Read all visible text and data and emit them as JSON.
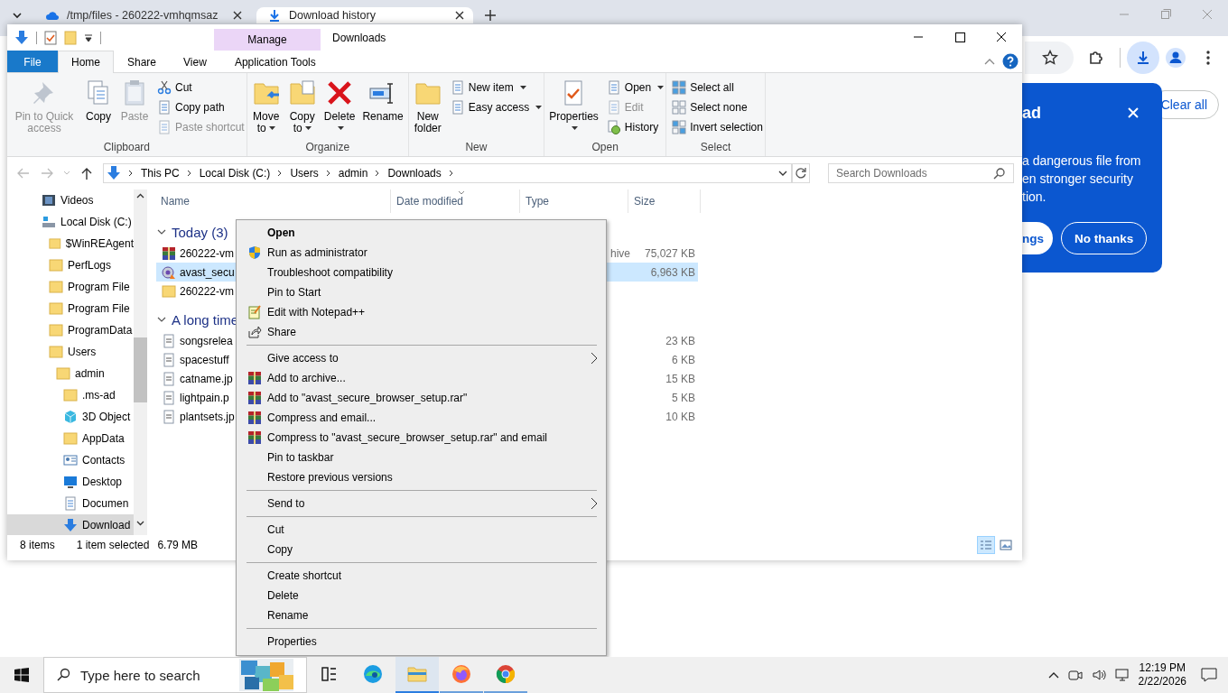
{
  "browser": {
    "tabs": [
      {
        "title": "/tmp/files - 260222-vmhqmsaz",
        "selected": false
      },
      {
        "title": "Download history",
        "selected": true
      }
    ],
    "download_bubble": {
      "title": "ad",
      "message_lines": [
        "a dangerous file from",
        "en stronger security",
        "tion."
      ],
      "buttons": [
        "ngs",
        "No thanks"
      ]
    },
    "page": {
      "clear_all": "Clear all"
    }
  },
  "explorer": {
    "title": "Downloads",
    "contextual_tab": "Manage",
    "ribbon_tabs": [
      {
        "label": "File",
        "selected": false
      },
      {
        "label": "Home",
        "selected": true
      },
      {
        "label": "Share",
        "selected": false
      },
      {
        "label": "View",
        "selected": false
      },
      {
        "label": "Application Tools",
        "selected": false
      }
    ],
    "ribbon_groups": [
      {
        "label": "Clipboard",
        "large": [
          {
            "label": "Pin to Quick access",
            "disabled": true,
            "dropdown": false
          },
          {
            "label": "Copy",
            "disabled": false,
            "dropdown": false
          },
          {
            "label": "Paste",
            "disabled": true,
            "dropdown": false
          }
        ],
        "small": [
          {
            "label": "Cut",
            "disabled": false,
            "dropdown": false
          },
          {
            "label": "Copy path",
            "disabled": false,
            "dropdown": false
          },
          {
            "label": "Paste shortcut",
            "disabled": true,
            "dropdown": false
          }
        ]
      },
      {
        "label": "Organize",
        "large": [
          {
            "label": "Move to",
            "disabled": false,
            "dropdown": true
          },
          {
            "label": "Copy to",
            "disabled": false,
            "dropdown": true
          },
          {
            "label": "Delete",
            "disabled": false,
            "dropdown": true
          },
          {
            "label": "Rename",
            "disabled": false,
            "dropdown": false
          }
        ]
      },
      {
        "label": "New",
        "large": [
          {
            "label": "New folder",
            "disabled": false,
            "dropdown": false
          }
        ],
        "small": [
          {
            "label": "New item",
            "disabled": false,
            "dropdown": true
          },
          {
            "label": "Easy access",
            "disabled": false,
            "dropdown": true
          }
        ]
      },
      {
        "label": "Open",
        "large": [
          {
            "label": "Properties",
            "disabled": false,
            "dropdown": true
          }
        ],
        "small": [
          {
            "label": "Open",
            "disabled": false,
            "dropdown": true
          },
          {
            "label": "Edit",
            "disabled": true,
            "dropdown": false
          },
          {
            "label": "History",
            "disabled": false,
            "dropdown": false
          }
        ]
      },
      {
        "label": "Select",
        "small": [
          {
            "label": "Select all",
            "disabled": false,
            "dropdown": false
          },
          {
            "label": "Select none",
            "disabled": false,
            "dropdown": false
          },
          {
            "label": "Invert selection",
            "disabled": false,
            "dropdown": false
          }
        ]
      }
    ],
    "breadcrumb": [
      "This PC",
      "Local Disk (C:)",
      "Users",
      "admin",
      "Downloads"
    ],
    "search": {
      "placeholder": "Search Downloads"
    },
    "nav": {
      "items": [
        {
          "label": "Videos",
          "kind": "videos",
          "selected": false
        },
        {
          "label": "Local Disk (C:)",
          "kind": "drive",
          "selected": false,
          "children": [
            {
              "label": "$WinREAgent",
              "kind": "folder",
              "selected": false
            },
            {
              "label": "PerfLogs",
              "kind": "folder",
              "selected": false
            },
            {
              "label": "Program File",
              "kind": "folder",
              "selected": false
            },
            {
              "label": "Program File",
              "kind": "folder",
              "selected": false
            },
            {
              "label": "ProgramData",
              "kind": "folder",
              "selected": false
            },
            {
              "label": "Users",
              "kind": "folder",
              "selected": false,
              "children": [
                {
                  "label": "admin",
                  "kind": "folder",
                  "selected": false,
                  "children": [
                    {
                      "label": ".ms-ad",
                      "kind": "folder",
                      "selected": false
                    },
                    {
                      "label": "3D Object",
                      "kind": "cube",
                      "selected": false
                    },
                    {
                      "label": "AppData",
                      "kind": "folder",
                      "selected": false
                    },
                    {
                      "label": "Contacts",
                      "kind": "contacts",
                      "selected": false
                    },
                    {
                      "label": "Desktop",
                      "kind": "desktop",
                      "selected": false
                    },
                    {
                      "label": "Documen",
                      "kind": "documents",
                      "selected": false
                    },
                    {
                      "label": "Download",
                      "kind": "downloads",
                      "selected": true
                    }
                  ]
                }
              ]
            }
          ]
        }
      ]
    },
    "columns": [
      "Name",
      "Date modified",
      "Type",
      "Size"
    ],
    "groups": [
      {
        "label": "Today (3)",
        "expanded": true,
        "rows": [
          {
            "name": "260222-vm",
            "type": "hive",
            "size": "75,027 KB",
            "kind": "archive",
            "selected": false
          },
          {
            "name": "avast_secu",
            "size": "6,963 KB",
            "kind": "setup",
            "selected": true
          },
          {
            "name": "260222-vm",
            "kind": "folder",
            "selected": false
          }
        ]
      },
      {
        "label": "A long time",
        "expanded": true,
        "rows": [
          {
            "name": "songsrelea",
            "size": "23 KB",
            "kind": "text",
            "selected": false
          },
          {
            "name": "spacestuff",
            "size": "6 KB",
            "kind": "text",
            "selected": false
          },
          {
            "name": "catname.jp",
            "size": "15 KB",
            "kind": "text",
            "selected": false
          },
          {
            "name": "lightpain.p",
            "size": "5 KB",
            "kind": "text",
            "selected": false
          },
          {
            "name": "plantsets.jp",
            "size": "10 KB",
            "kind": "text",
            "selected": false
          }
        ]
      }
    ],
    "status": {
      "count": "8 items",
      "selection": "1 item selected",
      "size": "6.79 MB"
    },
    "views": [
      {
        "selected": true
      },
      {
        "selected": false
      }
    ]
  },
  "context_menu": {
    "sections": [
      [
        {
          "label": "Open",
          "kind": "plain",
          "default": true,
          "submenu": false
        },
        {
          "label": "Run as administrator",
          "kind": "shield",
          "default": false,
          "submenu": false
        },
        {
          "label": "Troubleshoot compatibility",
          "kind": "plain",
          "default": false,
          "submenu": false
        },
        {
          "label": "Pin to Start",
          "kind": "plain",
          "default": false,
          "submenu": false
        },
        {
          "label": "Edit with Notepad++",
          "kind": "notepad",
          "default": false,
          "submenu": false
        },
        {
          "label": "Share",
          "kind": "share",
          "default": false,
          "submenu": false
        }
      ],
      [
        {
          "label": "Give access to",
          "kind": "plain",
          "default": false,
          "submenu": true
        },
        {
          "label": "Add to archive...",
          "kind": "archive",
          "default": false,
          "submenu": false
        },
        {
          "label": "Add to \"avast_secure_browser_setup.rar\"",
          "kind": "archive",
          "default": false,
          "submenu": false
        },
        {
          "label": "Compress and email...",
          "kind": "archive",
          "default": false,
          "submenu": false
        },
        {
          "label": "Compress to \"avast_secure_browser_setup.rar\" and email",
          "kind": "archive",
          "default": false,
          "submenu": false
        },
        {
          "label": "Pin to taskbar",
          "kind": "plain",
          "default": false,
          "submenu": false
        },
        {
          "label": "Restore previous versions",
          "kind": "plain",
          "default": false,
          "submenu": false
        }
      ],
      [
        {
          "label": "Send to",
          "kind": "plain",
          "default": false,
          "submenu": true
        }
      ],
      [
        {
          "label": "Cut",
          "kind": "plain",
          "default": false,
          "submenu": false
        },
        {
          "label": "Copy",
          "kind": "plain",
          "default": false,
          "submenu": false
        }
      ],
      [
        {
          "label": "Create shortcut",
          "kind": "plain",
          "default": false,
          "submenu": false
        },
        {
          "label": "Delete",
          "kind": "plain",
          "default": false,
          "submenu": false
        },
        {
          "label": "Rename",
          "kind": "plain",
          "default": false,
          "submenu": false
        }
      ],
      [
        {
          "label": "Properties",
          "kind": "plain",
          "default": false,
          "submenu": false
        }
      ]
    ]
  },
  "taskbar": {
    "search": {
      "placeholder": "Type here to search"
    },
    "apps": [
      {
        "kind": "taskview",
        "active": false,
        "running": false
      },
      {
        "kind": "edge",
        "active": false,
        "running": false
      },
      {
        "kind": "explorer",
        "active": true,
        "running": true
      },
      {
        "kind": "firefox",
        "active": false,
        "running": true
      },
      {
        "kind": "chrome",
        "active": false,
        "running": true
      }
    ],
    "time": "12:19 PM",
    "date": "2/22/2026"
  }
}
